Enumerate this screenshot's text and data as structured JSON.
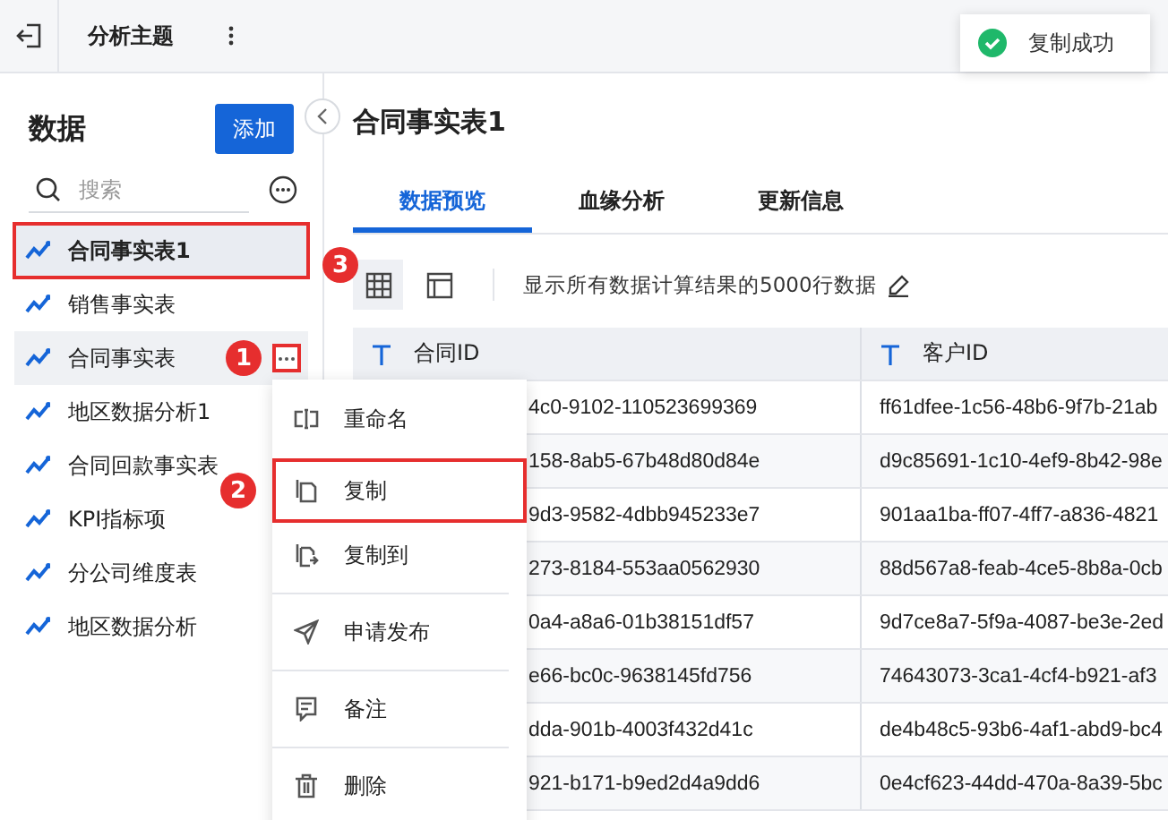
{
  "topbar": {
    "title": "分析主题"
  },
  "toast": {
    "message": "复制成功"
  },
  "sidebar": {
    "heading": "数据",
    "add_button": "添加",
    "search": {
      "placeholder": "搜索"
    },
    "items": [
      {
        "label": "合同事实表1",
        "selected": true,
        "outlined": true,
        "hovered": false
      },
      {
        "label": "销售事实表",
        "selected": false,
        "outlined": false,
        "hovered": false
      },
      {
        "label": "合同事实表",
        "selected": false,
        "outlined": false,
        "hovered": true,
        "callout": "1",
        "more_outlined": true
      },
      {
        "label": "地区数据分析1",
        "selected": false,
        "outlined": false,
        "hovered": false
      },
      {
        "label": "合同回款事实表",
        "selected": false,
        "outlined": false,
        "hovered": false
      },
      {
        "label": "KPI指标项",
        "selected": false,
        "outlined": false,
        "hovered": false
      },
      {
        "label": "分公司维度表",
        "selected": false,
        "outlined": false,
        "hovered": false
      },
      {
        "label": "地区数据分析",
        "selected": false,
        "outlined": false,
        "hovered": false
      }
    ]
  },
  "main": {
    "title": "合同事实表1",
    "tabs": [
      {
        "label": "数据预览",
        "selected": true
      },
      {
        "label": "血缘分析",
        "selected": false
      },
      {
        "label": "更新信息",
        "selected": false
      }
    ],
    "views": [
      {
        "kind": "grid",
        "selected": true,
        "callout": "3"
      },
      {
        "kind": "layout",
        "selected": false
      }
    ],
    "row_note": "显示所有数据计算结果的5000行数据",
    "table": {
      "columns": [
        "合同ID",
        "客户ID"
      ],
      "rows": [
        [
          "4c0-9102-110523699369",
          "ff61dfee-1c56-48b6-9f7b-21ab"
        ],
        [
          "158-8ab5-67b48d80d84e",
          "d9c85691-1c10-4ef9-8b42-98e"
        ],
        [
          "9d3-9582-4dbb945233e7",
          "901aa1ba-ff07-4ff7-a836-4821"
        ],
        [
          "273-8184-553aa0562930",
          "88d567a8-feab-4ce5-8b8a-0cb"
        ],
        [
          "0a4-a8a6-01b38151df57",
          "9d7ce8a7-5f9a-4087-be3e-2ed"
        ],
        [
          "e66-bc0c-9638145fd756",
          "74643073-3ca1-4cf4-b921-af3"
        ],
        [
          "dda-901b-4003f432d41c",
          "de4b48c5-93b6-4af1-abd9-bc4"
        ],
        [
          "921-b171-b9ed2d4a9dd6",
          "0e4cf623-44dd-470a-8a39-5bc"
        ]
      ]
    }
  },
  "context_menu": {
    "items": [
      {
        "kind": "rename",
        "label": "重命名",
        "divider_before": false,
        "outlined": false
      },
      {
        "kind": "copy",
        "label": "复制",
        "divider_before": false,
        "outlined": true,
        "callout": "2"
      },
      {
        "kind": "copy_to",
        "label": "复制到",
        "divider_before": false,
        "outlined": false
      },
      {
        "kind": "publish",
        "label": "申请发布",
        "divider_before": true,
        "outlined": false
      },
      {
        "kind": "note",
        "label": "备注",
        "divider_before": true,
        "outlined": false
      },
      {
        "kind": "delete",
        "label": "删除",
        "divider_before": true,
        "outlined": false
      }
    ]
  }
}
